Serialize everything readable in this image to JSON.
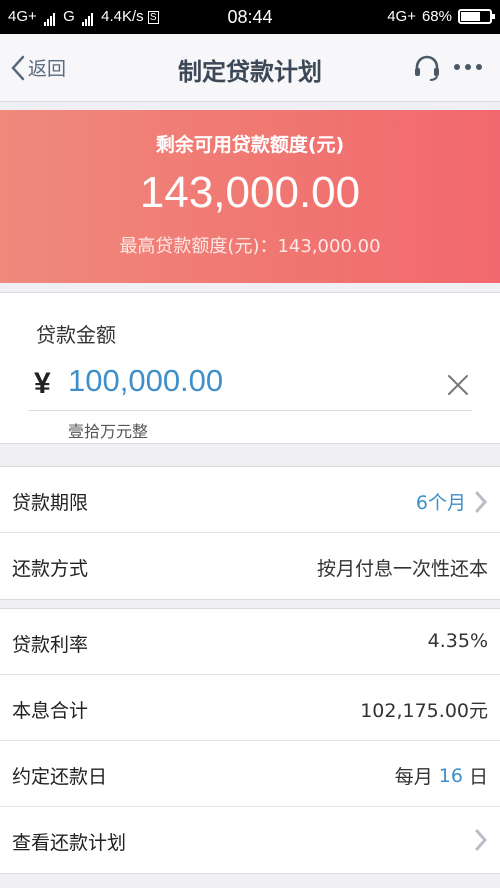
{
  "status_bar": {
    "network1": "4G+",
    "network2": "G",
    "speed": "4.4K/s",
    "extra_icon": "S",
    "time": "08:44",
    "right_network": "4G+",
    "battery": "68%",
    "battery_level": 0.68
  },
  "nav": {
    "back_label": "返回",
    "title": "制定贷款计划",
    "service_icon": "headset-icon",
    "more_icon": "more-icon"
  },
  "banner": {
    "title": "剩余可用贷款额度(元)",
    "amount": "143,000.00",
    "max_label": "最高贷款额度(元)：143,000.00"
  },
  "loan_amount": {
    "label": "贷款金额",
    "currency": "¥",
    "value": "100,000.00",
    "words": "壹拾万元整"
  },
  "terms": [
    {
      "label": "贷款期限",
      "value": "6个月"
    },
    {
      "label": "还款方式",
      "value": "按月付息一次性还本"
    }
  ],
  "details": [
    {
      "label": "贷款利率",
      "value": "4.35%"
    },
    {
      "label": "本息合计",
      "value": "102,175.00元"
    },
    {
      "label": "约定还款日",
      "prefix": "每月 ",
      "day": "16",
      "suffix": " 日"
    },
    {
      "label": "查看还款计划"
    }
  ],
  "colors": {
    "accent": "#3f8fc9",
    "banner": "#f07571"
  }
}
